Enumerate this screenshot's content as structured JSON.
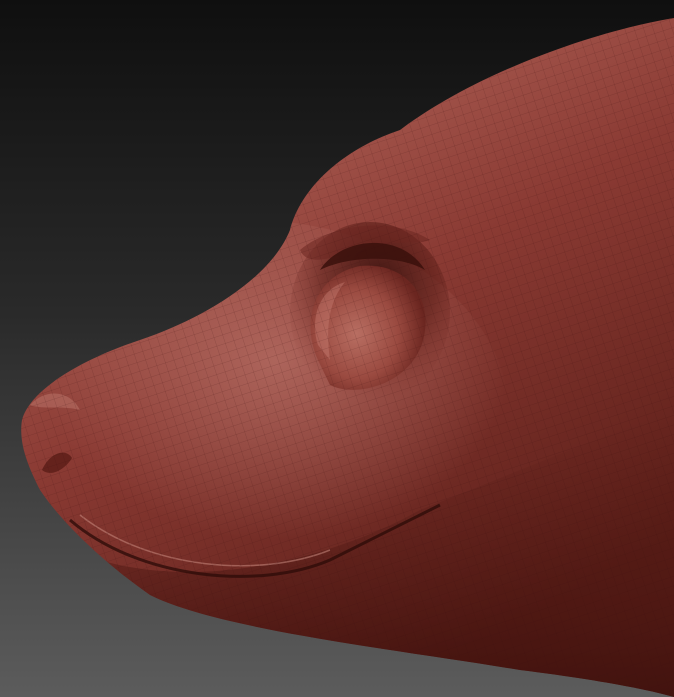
{
  "scene": {
    "subject": "sculpted-animal-head-side-view",
    "colors": {
      "background_top": "#0f0f0f",
      "background_bottom": "#5c5c5c",
      "clay_base": "#8a3a33",
      "clay_highlight": "#b4675c",
      "clay_shadow": "#4a1611",
      "clay_deep": "#2e0c09",
      "wire": "#3a100c"
    }
  }
}
